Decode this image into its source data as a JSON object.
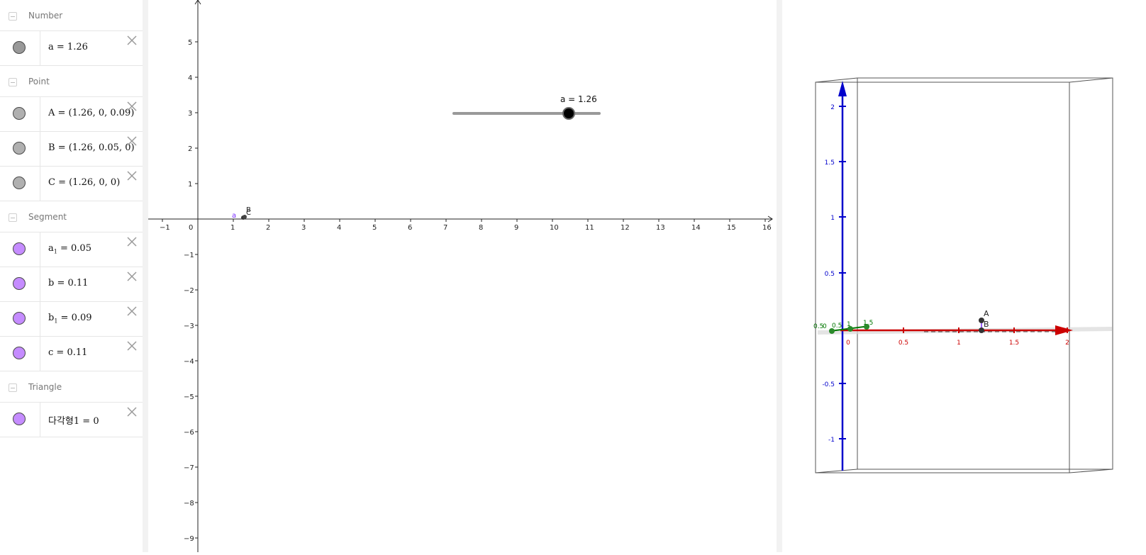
{
  "algebra": {
    "groups": [
      {
        "label": "Number",
        "items": [
          {
            "name_main": "a",
            "name_sub": "",
            "value": " = 1.26",
            "color": "#999999",
            "active": true
          }
        ]
      },
      {
        "label": "Point",
        "items": [
          {
            "name_main": "A",
            "name_sub": "",
            "value": " = (1.26, 0, 0.09)",
            "color": "#b0b0b0",
            "active": false
          },
          {
            "name_main": "B",
            "name_sub": "",
            "value": " = (1.26, 0.05, 0)",
            "color": "#b0b0b0",
            "active": false
          },
          {
            "name_main": "C",
            "name_sub": "",
            "value": " = (1.26, 0, 0)",
            "color": "#b0b0b0",
            "active": false
          }
        ]
      },
      {
        "label": "Segment",
        "items": [
          {
            "name_main": "a",
            "name_sub": "1",
            "value": " = 0.05",
            "color": "#c58cff",
            "active": false
          },
          {
            "name_main": "b",
            "name_sub": "",
            "value": " = 0.11",
            "color": "#c58cff",
            "active": false
          },
          {
            "name_main": "b",
            "name_sub": "1",
            "value": " = 0.09",
            "color": "#c58cff",
            "active": false
          },
          {
            "name_main": "c",
            "name_sub": "",
            "value": " = 0.11",
            "color": "#c58cff",
            "active": false
          }
        ]
      },
      {
        "label": "Triangle",
        "items": [
          {
            "name_main": "다각형1",
            "name_sub": "",
            "value": " = 0",
            "color": "#c58cff",
            "active": false
          }
        ]
      }
    ],
    "delete_icon": "close-icon",
    "collapse_icon": "minus-icon"
  },
  "graphics2d": {
    "x_ticks": [
      "−1",
      "0",
      "1",
      "2",
      "3",
      "4",
      "5",
      "6",
      "7",
      "8",
      "9",
      "10",
      "11",
      "12",
      "13",
      "14",
      "15",
      "16"
    ],
    "y_ticks_pos": [
      "1",
      "2",
      "3",
      "4",
      "5"
    ],
    "y_ticks_neg": [
      "−1",
      "−2",
      "−3",
      "−4",
      "−5",
      "−6",
      "−7",
      "−8",
      "−9"
    ],
    "slider": {
      "label": "a = 1.26",
      "value": 1.26
    },
    "point_labels": {
      "a": "a",
      "b": "B",
      "c": "C"
    },
    "colors": {
      "axis": "#222222",
      "slider": "#999999",
      "segment": "#7b2fff",
      "point": "#333333"
    }
  },
  "graphics3d": {
    "z_ticks": [
      "2",
      "1.5",
      "1",
      "0.5",
      "-0.5",
      "-1"
    ],
    "x_ticks": [
      "0",
      "0.5",
      "1",
      "1.5",
      "2"
    ],
    "y_ticks": [
      "0.5",
      "0",
      "0.5",
      "1",
      "1.5"
    ],
    "point_labels": {
      "a": "A",
      "b": "B"
    },
    "colors": {
      "z_axis": "#0000cc",
      "x_axis": "#cc0000",
      "y_axis": "#007700",
      "box": "#555555"
    }
  }
}
